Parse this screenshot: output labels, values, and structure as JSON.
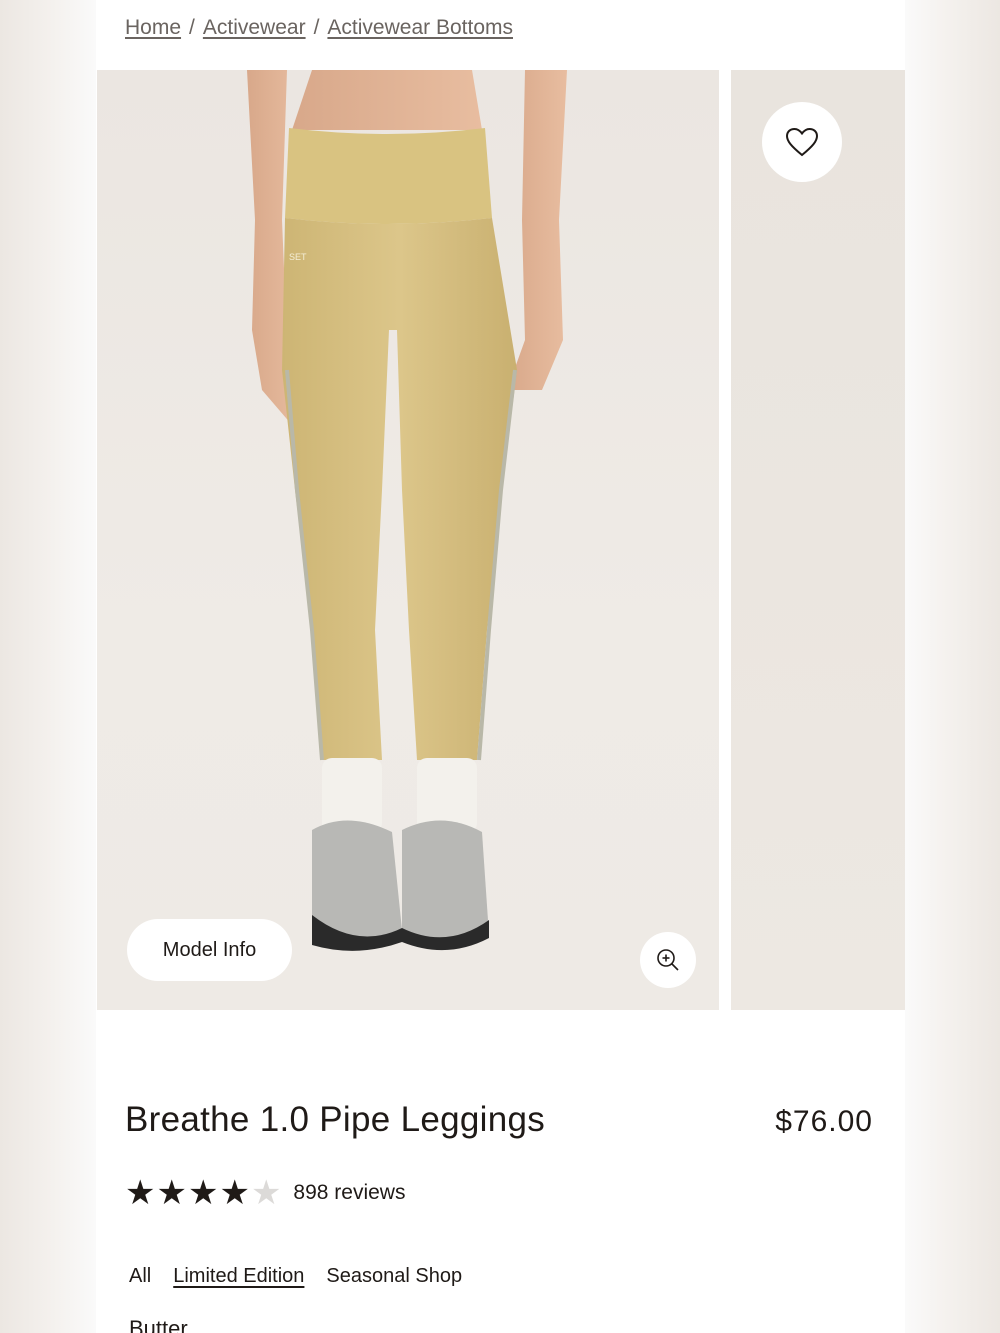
{
  "breadcrumb": {
    "items": [
      "Home",
      "Activewear",
      "Activewear Bottoms"
    ],
    "separator": "/"
  },
  "gallery": {
    "model_info_label": "Model Info",
    "wishlist_icon": "heart-icon",
    "zoom_icon": "zoom-in-icon",
    "brand_mark": "SET"
  },
  "product": {
    "title": "Breathe 1.0 Pipe Leggings",
    "price": "$76.00",
    "rating": 4,
    "rating_max": 5,
    "reviews_label": "898 reviews"
  },
  "tags": [
    {
      "label": "All",
      "linked": false
    },
    {
      "label": "Limited Edition",
      "linked": true
    },
    {
      "label": "Seasonal Shop",
      "linked": false
    }
  ],
  "color": {
    "label": "Butter"
  },
  "colors": {
    "legging": "#d6c183",
    "background": "#ffffff",
    "text": "#1f1a17"
  }
}
